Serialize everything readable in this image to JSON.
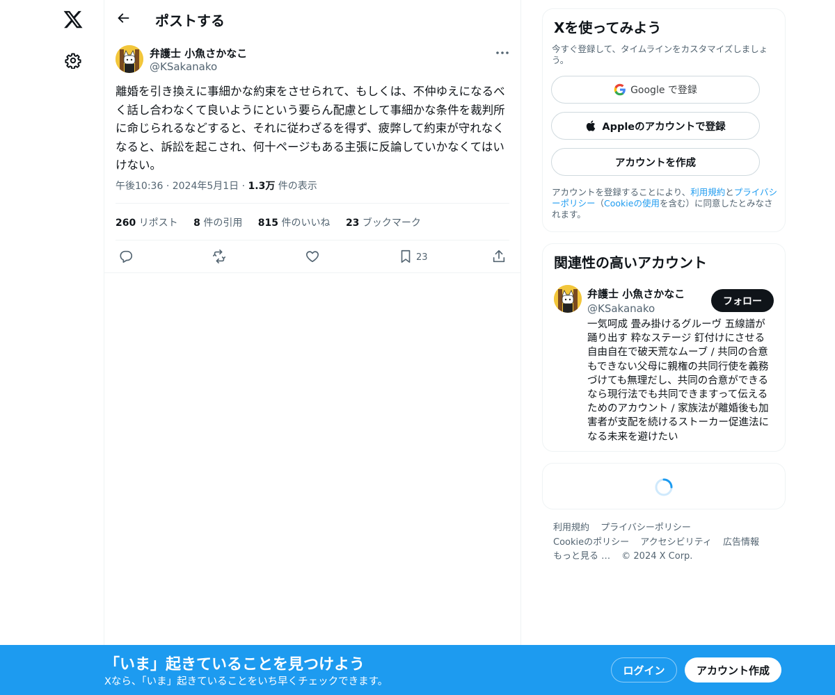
{
  "nav": {
    "logo_icon": "x-logo-icon",
    "settings_icon": "gear-icon"
  },
  "header": {
    "title": "ポストする",
    "back_icon": "arrow-left-icon"
  },
  "post": {
    "author_name": "弁護士 小魚さかなこ",
    "author_handle": "@KSakanako",
    "text": "離婚を引き換えに事細かな約束をさせられて、もしくは、不仲ゆえになるべく話し合わなくて良いようにという要らん配慮として事細かな条件を裁判所に命じられるなどすると、それに従わざるを得ず、疲弊して約束が守れなくなると、訴訟を起こされ、何十ページもある主張に反論していかなくてはいけない。",
    "time": "午後10:36",
    "date": "2024年5月1日",
    "views_count": "1.3万",
    "views_label": "件の表示",
    "stats": [
      {
        "count": "260",
        "label": "リポスト"
      },
      {
        "count": "8",
        "label": "件の引用"
      },
      {
        "count": "815",
        "label": "件のいいね"
      },
      {
        "count": "23",
        "label": "ブックマーク"
      }
    ],
    "bookmark_count": "23"
  },
  "signup_card": {
    "title": "Xを使ってみよう",
    "subtitle": "今すぐ登録して、タイムラインをカスタマイズしましょう。",
    "google_label": "Google で登録",
    "apple_label": "Appleのアカウントで登録",
    "create_label": "アカウントを作成",
    "legal_pre": "アカウントを登録することにより、",
    "legal_terms": "利用規約",
    "legal_and": "と",
    "legal_privacy": "プライバシーポリシー",
    "legal_open": "（",
    "legal_cookie": "Cookieの使用",
    "legal_post": "を含む）に同意したとみなされます。"
  },
  "related": {
    "title": "関連性の高いアカウント",
    "name": "弁護士 小魚さかなこ",
    "handle": "@KSakanako",
    "follow_label": "フォロー",
    "bio": "一気呵成 畳み掛けるグルーヴ 五線譜が踊り出す 粋なステージ 釘付けにさせる 自由自在で破天荒なムーブ / 共同の合意もできない父母に親権の共同行使を義務づけても無理だし、共同の合意ができるなら現行法でも共同できますって伝えるためのアカウント / 家族法が離婚後も加害者が支配を続けるストーカー促進法になる未来を避けたい"
  },
  "footer": {
    "links": [
      "利用規約",
      "プライバシーポリシー",
      "Cookieのポリシー",
      "アクセシビリティ",
      "広告情報",
      "もっと見る …"
    ],
    "copyright": "© 2024 X Corp."
  },
  "bottom_bar": {
    "title": "「いま」起きていることを見つけよう",
    "subtitle": "Xなら、「いま」起きていることをいち早くチェックできます。",
    "login_label": "ログイン",
    "signup_label": "アカウント作成"
  },
  "colors": {
    "accent": "#1d9bf0",
    "text": "#0f1419",
    "muted": "#536471"
  }
}
